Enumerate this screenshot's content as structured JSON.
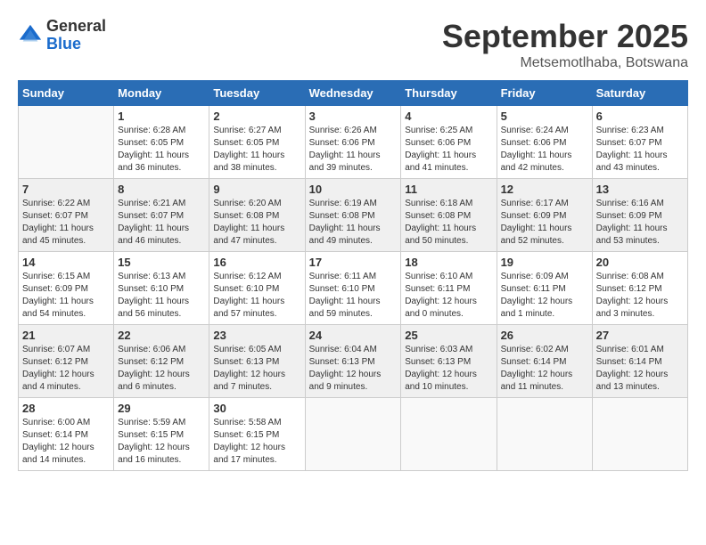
{
  "logo": {
    "general": "General",
    "blue": "Blue"
  },
  "title": "September 2025",
  "location": "Metsemotlhaba, Botswana",
  "weekdays": [
    "Sunday",
    "Monday",
    "Tuesday",
    "Wednesday",
    "Thursday",
    "Friday",
    "Saturday"
  ],
  "weeks": [
    [
      {
        "day": "",
        "sunrise": "",
        "sunset": "",
        "daylight": ""
      },
      {
        "day": "1",
        "sunrise": "Sunrise: 6:28 AM",
        "sunset": "Sunset: 6:05 PM",
        "daylight": "Daylight: 11 hours and 36 minutes."
      },
      {
        "day": "2",
        "sunrise": "Sunrise: 6:27 AM",
        "sunset": "Sunset: 6:05 PM",
        "daylight": "Daylight: 11 hours and 38 minutes."
      },
      {
        "day": "3",
        "sunrise": "Sunrise: 6:26 AM",
        "sunset": "Sunset: 6:06 PM",
        "daylight": "Daylight: 11 hours and 39 minutes."
      },
      {
        "day": "4",
        "sunrise": "Sunrise: 6:25 AM",
        "sunset": "Sunset: 6:06 PM",
        "daylight": "Daylight: 11 hours and 41 minutes."
      },
      {
        "day": "5",
        "sunrise": "Sunrise: 6:24 AM",
        "sunset": "Sunset: 6:06 PM",
        "daylight": "Daylight: 11 hours and 42 minutes."
      },
      {
        "day": "6",
        "sunrise": "Sunrise: 6:23 AM",
        "sunset": "Sunset: 6:07 PM",
        "daylight": "Daylight: 11 hours and 43 minutes."
      }
    ],
    [
      {
        "day": "7",
        "sunrise": "Sunrise: 6:22 AM",
        "sunset": "Sunset: 6:07 PM",
        "daylight": "Daylight: 11 hours and 45 minutes."
      },
      {
        "day": "8",
        "sunrise": "Sunrise: 6:21 AM",
        "sunset": "Sunset: 6:07 PM",
        "daylight": "Daylight: 11 hours and 46 minutes."
      },
      {
        "day": "9",
        "sunrise": "Sunrise: 6:20 AM",
        "sunset": "Sunset: 6:08 PM",
        "daylight": "Daylight: 11 hours and 47 minutes."
      },
      {
        "day": "10",
        "sunrise": "Sunrise: 6:19 AM",
        "sunset": "Sunset: 6:08 PM",
        "daylight": "Daylight: 11 hours and 49 minutes."
      },
      {
        "day": "11",
        "sunrise": "Sunrise: 6:18 AM",
        "sunset": "Sunset: 6:08 PM",
        "daylight": "Daylight: 11 hours and 50 minutes."
      },
      {
        "day": "12",
        "sunrise": "Sunrise: 6:17 AM",
        "sunset": "Sunset: 6:09 PM",
        "daylight": "Daylight: 11 hours and 52 minutes."
      },
      {
        "day": "13",
        "sunrise": "Sunrise: 6:16 AM",
        "sunset": "Sunset: 6:09 PM",
        "daylight": "Daylight: 11 hours and 53 minutes."
      }
    ],
    [
      {
        "day": "14",
        "sunrise": "Sunrise: 6:15 AM",
        "sunset": "Sunset: 6:09 PM",
        "daylight": "Daylight: 11 hours and 54 minutes."
      },
      {
        "day": "15",
        "sunrise": "Sunrise: 6:13 AM",
        "sunset": "Sunset: 6:10 PM",
        "daylight": "Daylight: 11 hours and 56 minutes."
      },
      {
        "day": "16",
        "sunrise": "Sunrise: 6:12 AM",
        "sunset": "Sunset: 6:10 PM",
        "daylight": "Daylight: 11 hours and 57 minutes."
      },
      {
        "day": "17",
        "sunrise": "Sunrise: 6:11 AM",
        "sunset": "Sunset: 6:10 PM",
        "daylight": "Daylight: 11 hours and 59 minutes."
      },
      {
        "day": "18",
        "sunrise": "Sunrise: 6:10 AM",
        "sunset": "Sunset: 6:11 PM",
        "daylight": "Daylight: 12 hours and 0 minutes."
      },
      {
        "day": "19",
        "sunrise": "Sunrise: 6:09 AM",
        "sunset": "Sunset: 6:11 PM",
        "daylight": "Daylight: 12 hours and 1 minute."
      },
      {
        "day": "20",
        "sunrise": "Sunrise: 6:08 AM",
        "sunset": "Sunset: 6:12 PM",
        "daylight": "Daylight: 12 hours and 3 minutes."
      }
    ],
    [
      {
        "day": "21",
        "sunrise": "Sunrise: 6:07 AM",
        "sunset": "Sunset: 6:12 PM",
        "daylight": "Daylight: 12 hours and 4 minutes."
      },
      {
        "day": "22",
        "sunrise": "Sunrise: 6:06 AM",
        "sunset": "Sunset: 6:12 PM",
        "daylight": "Daylight: 12 hours and 6 minutes."
      },
      {
        "day": "23",
        "sunrise": "Sunrise: 6:05 AM",
        "sunset": "Sunset: 6:13 PM",
        "daylight": "Daylight: 12 hours and 7 minutes."
      },
      {
        "day": "24",
        "sunrise": "Sunrise: 6:04 AM",
        "sunset": "Sunset: 6:13 PM",
        "daylight": "Daylight: 12 hours and 9 minutes."
      },
      {
        "day": "25",
        "sunrise": "Sunrise: 6:03 AM",
        "sunset": "Sunset: 6:13 PM",
        "daylight": "Daylight: 12 hours and 10 minutes."
      },
      {
        "day": "26",
        "sunrise": "Sunrise: 6:02 AM",
        "sunset": "Sunset: 6:14 PM",
        "daylight": "Daylight: 12 hours and 11 minutes."
      },
      {
        "day": "27",
        "sunrise": "Sunrise: 6:01 AM",
        "sunset": "Sunset: 6:14 PM",
        "daylight": "Daylight: 12 hours and 13 minutes."
      }
    ],
    [
      {
        "day": "28",
        "sunrise": "Sunrise: 6:00 AM",
        "sunset": "Sunset: 6:14 PM",
        "daylight": "Daylight: 12 hours and 14 minutes."
      },
      {
        "day": "29",
        "sunrise": "Sunrise: 5:59 AM",
        "sunset": "Sunset: 6:15 PM",
        "daylight": "Daylight: 12 hours and 16 minutes."
      },
      {
        "day": "30",
        "sunrise": "Sunrise: 5:58 AM",
        "sunset": "Sunset: 6:15 PM",
        "daylight": "Daylight: 12 hours and 17 minutes."
      },
      {
        "day": "",
        "sunrise": "",
        "sunset": "",
        "daylight": ""
      },
      {
        "day": "",
        "sunrise": "",
        "sunset": "",
        "daylight": ""
      },
      {
        "day": "",
        "sunrise": "",
        "sunset": "",
        "daylight": ""
      },
      {
        "day": "",
        "sunrise": "",
        "sunset": "",
        "daylight": ""
      }
    ]
  ]
}
